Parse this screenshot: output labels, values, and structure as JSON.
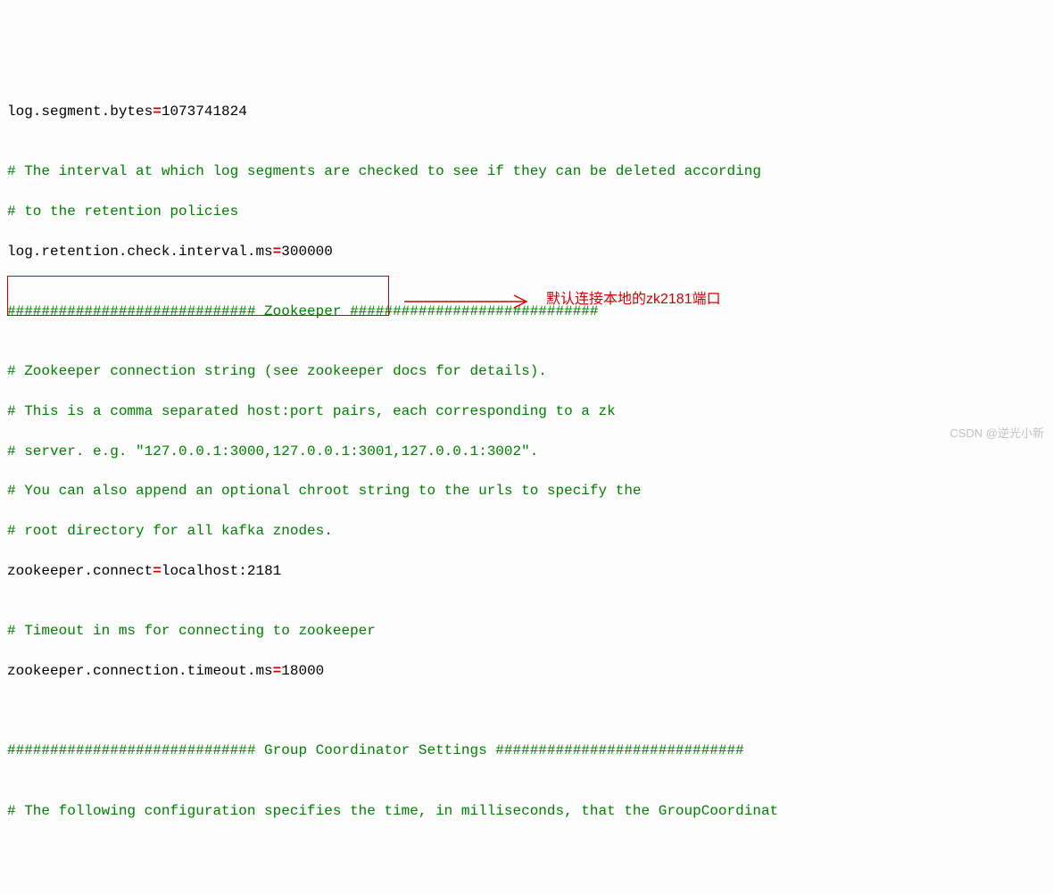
{
  "lines": {
    "l1_key": "log.segment.bytes",
    "l1_val": "1073741824",
    "l2": "",
    "l3": "# The interval at which log segments are checked to see if they can be deleted according",
    "l4": "# to the retention policies",
    "l5_key": "log.retention.check.interval.ms",
    "l5_val": "300000",
    "l6": "",
    "l7": "############################# Zookeeper #############################",
    "l8": "",
    "l9": "# Zookeeper connection string (see zookeeper docs for details).",
    "l10": "# This is a comma separated host:port pairs, each corresponding to a zk",
    "l11": "# server. e.g. \"127.0.0.1:3000,127.0.0.1:3001,127.0.0.1:3002\".",
    "l12": "# You can also append an optional chroot string to the urls to specify the",
    "l13": "# root directory for all kafka znodes.",
    "l14_key": "zookeeper.connect",
    "l14_val": "localhost:2181",
    "l15": "",
    "l16": "# Timeout in ms for connecting to zookeeper",
    "l17_key": "zookeeper.connection.timeout.ms",
    "l17_val": "18000",
    "l18": "",
    "l19": "",
    "l20": "############################# Group Coordinator Settings #############################",
    "l21": "",
    "l22": "# The following configuration specifies the time, in milliseconds, that the GroupCoordinat"
  },
  "eq": "=",
  "annotation": {
    "text": "默认连接本地的zk2181端口"
  },
  "watermark": "CSDN @逆光小新"
}
